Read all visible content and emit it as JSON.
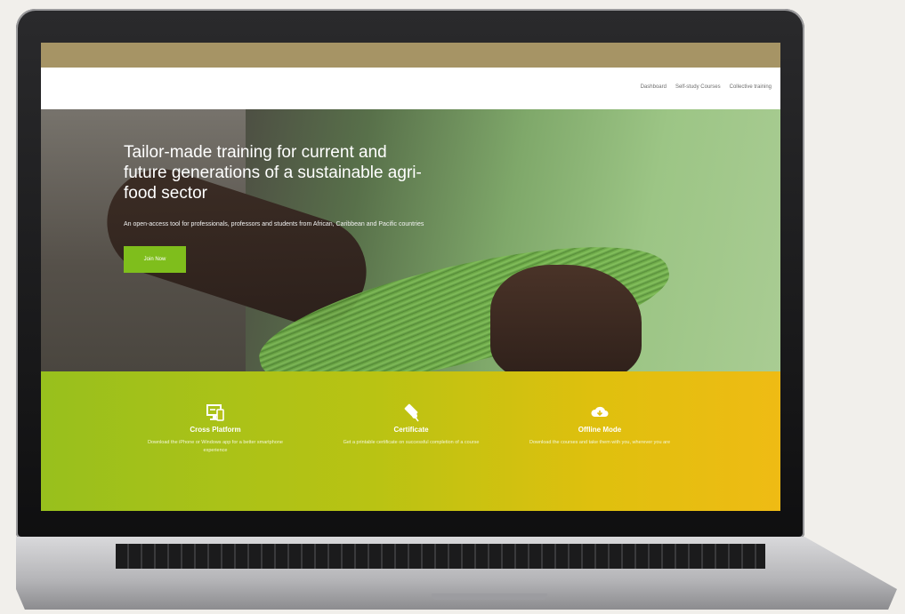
{
  "nav": {
    "links": [
      "Dashboard",
      "Self-study Courses",
      "Collective training"
    ]
  },
  "hero": {
    "title": "Tailor-made training for current and future generations of a sustainable agri-food sector",
    "subtitle": "An open-access tool for professionals, professors and students from African, Caribbean and Pacific countries",
    "cta_label": "Join Now"
  },
  "features": [
    {
      "icon": "cross-platform-icon",
      "title": "Cross Platform",
      "text": "Download the iPhone or Windows app for a better smartphone experience"
    },
    {
      "icon": "certificate-icon",
      "title": "Certificate",
      "text": "Get a printable certificate on successful completion of a course"
    },
    {
      "icon": "cloud-download-icon",
      "title": "Offline Mode",
      "text": "Download the courses and take them with you, wherever you are"
    }
  ],
  "colors": {
    "accent_strip": "#a69465",
    "cta": "#7fbe1c",
    "feature_band_start": "#98c01d",
    "feature_band_end": "#efbb14"
  }
}
